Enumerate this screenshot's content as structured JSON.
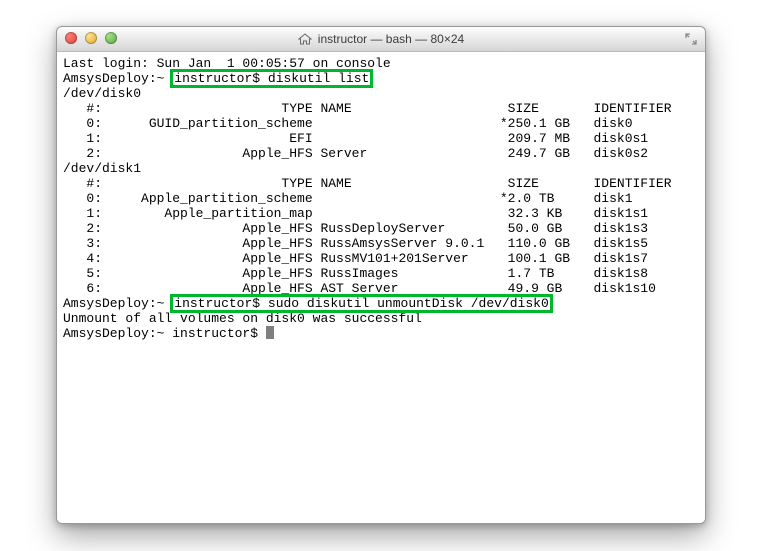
{
  "window": {
    "title": "instructor — bash — 80×24"
  },
  "session": {
    "last_login": "Last login: Sun Jan  1 00:05:57 on console",
    "host": "AmsysDeploy",
    "cwd": "~",
    "user": "instructor",
    "ps_char": "$"
  },
  "commands": {
    "cmd1": "diskutil list",
    "cmd2": "sudo diskutil unmountDisk /dev/disk0"
  },
  "disks": [
    {
      "device": "/dev/disk0",
      "header": "   #:                       TYPE NAME                    SIZE       IDENTIFIER",
      "rows": [
        "   0:      GUID_partition_scheme                        *250.1 GB   disk0",
        "   1:                        EFI                         209.7 MB   disk0s1",
        "   2:                  Apple_HFS Server                  249.7 GB   disk0s2"
      ]
    },
    {
      "device": "/dev/disk1",
      "header": "   #:                       TYPE NAME                    SIZE       IDENTIFIER",
      "rows": [
        "   0:     Apple_partition_scheme                        *2.0 TB     disk1",
        "   1:        Apple_partition_map                         32.3 KB    disk1s1",
        "   2:                  Apple_HFS RussDeployServer        50.0 GB    disk1s3",
        "   3:                  Apple_HFS RussAmsysServer 9.0.1   110.0 GB   disk1s5",
        "   4:                  Apple_HFS RussMV101+201Server     100.1 GB   disk1s7",
        "   5:                  Apple_HFS RussImages              1.7 TB     disk1s8",
        "   6:                  Apple_HFS AST Server              49.9 GB    disk1s10"
      ]
    }
  ],
  "result": "Unmount of all volumes on disk0 was successful",
  "prompt_trailing": "AmsysDeploy:~ instructor$ "
}
